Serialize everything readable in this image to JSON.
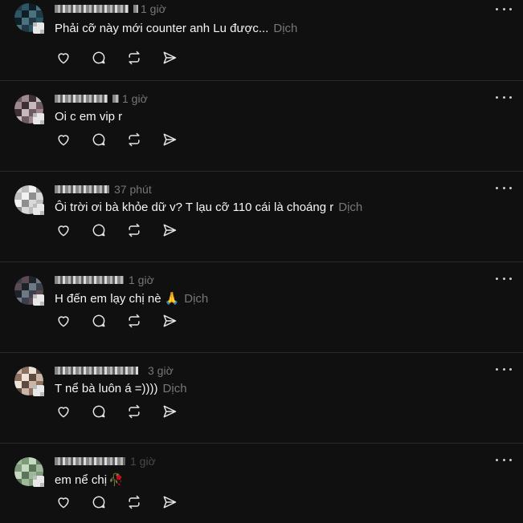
{
  "comments": [
    {
      "username": "",
      "time": "1 giờ",
      "text": "Phải cỡ này mới counter anh Lu được...",
      "emoji": "",
      "translate": "Dịch",
      "avatar_colors": [
        "#1f3a44",
        "#2e5563",
        "#0d1e24",
        "#4b7080"
      ]
    },
    {
      "username": "",
      "time": "1 giờ",
      "text": "Oi c em vip r",
      "emoji": "",
      "translate": "",
      "avatar_colors": [
        "#6e5a63",
        "#9f8891",
        "#3e2f35",
        "#c7b8bd"
      ]
    },
    {
      "username": "",
      "time": "37 phút",
      "text": "Ôi trời ơi bà khỏe dữ v? T lạu cỡ 110 cái là choáng r",
      "emoji": "",
      "translate": "Dịch",
      "avatar_colors": [
        "#d9d9d9",
        "#bdbdbd",
        "#f2f2f2",
        "#8f8f8f"
      ]
    },
    {
      "username": "",
      "time": "1 giờ",
      "text": "H đến em lạy chị nè",
      "emoji": "🙏",
      "translate": "Dịch",
      "avatar_colors": [
        "#3a3f4a",
        "#5b4a52",
        "#1e2229",
        "#6d7a86"
      ]
    },
    {
      "username": "",
      "time": "3 giờ",
      "text": "T nể bà luôn á =))))",
      "emoji": "",
      "translate": "Dịch",
      "avatar_colors": [
        "#c9b6a6",
        "#8d7060",
        "#efe3d8",
        "#5e4a3e"
      ]
    },
    {
      "username": "",
      "time": "1 giờ",
      "text": "em nể chị",
      "emoji": "🥀",
      "translate": "",
      "avatar_colors": [
        "#9fb89a",
        "#7d9a7a",
        "#c6d8c1",
        "#5a7658"
      ]
    }
  ],
  "icons": {
    "like": "heart-icon",
    "reply": "comment-icon",
    "repost": "repost-icon",
    "share": "send-icon",
    "more": "more-icon"
  },
  "colors": {
    "background": "#101010",
    "divider": "#2a2a2a",
    "text": "#f3f5f7",
    "muted": "#777777"
  }
}
